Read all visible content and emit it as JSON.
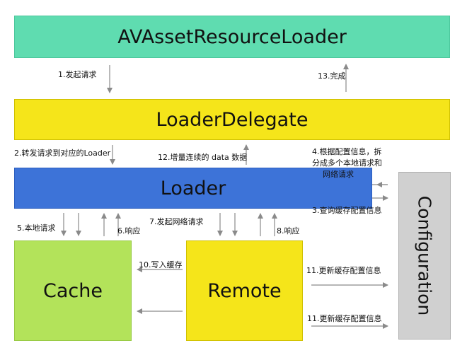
{
  "boxes": {
    "avasset": "AVAssetResourceLoader",
    "delegate": "LoaderDelegate",
    "loader": "Loader",
    "cache": "Cache",
    "remote": "Remote",
    "config": "Configuration"
  },
  "labels": {
    "l1": "1.发起请求",
    "l13": "13.完成",
    "l2": "2.转发请求到对应的Loader",
    "l12": "12.增量连续的 data 数据",
    "l4a": "4.根据配置信息，拆",
    "l4b": "分成多个本地请求和",
    "l4c": "网络请求",
    "l3": "3.查询缓存配置信息",
    "l5": "5.本地请求",
    "l6": "6.响应",
    "l7": "7.发起网络请求",
    "l8": "8.响应",
    "l10": "10.写入缓存",
    "l11a": "11.更新缓存配置信息",
    "l11b": "11.更新缓存配置信息"
  },
  "colors": {
    "avasset": "#5fdcb0",
    "delegate": "#f5e51a",
    "loader": "#3d73d8",
    "cache": "#b3e35a",
    "remote": "#f5e51a",
    "config": "#d0d0d0",
    "arrow": "#8a8a8a"
  }
}
